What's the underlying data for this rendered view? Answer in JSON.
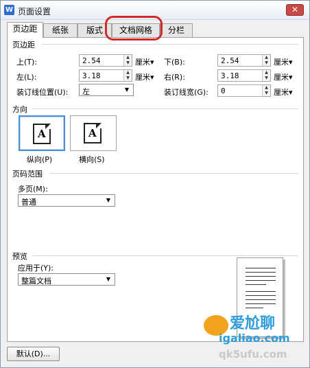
{
  "window": {
    "title": "页面设置",
    "icon": "W",
    "close": "✕"
  },
  "tabs": [
    "页边距",
    "纸张",
    "版式",
    "文档网格",
    "分栏"
  ],
  "margins": {
    "section_title": "页边距",
    "top": {
      "label": "上(T):",
      "value": "2.54",
      "unit": "厘米"
    },
    "bottom": {
      "label": "下(B):",
      "value": "2.54",
      "unit": "厘米"
    },
    "left": {
      "label": "左(L):",
      "value": "3.18",
      "unit": "厘米"
    },
    "right": {
      "label": "右(R):",
      "value": "3.18",
      "unit": "厘米"
    },
    "gutter_pos": {
      "label": "装订线位置(U):",
      "value": "左"
    },
    "gutter_width": {
      "label": "装订线宽(G):",
      "value": "0",
      "unit": "厘米"
    }
  },
  "orientation": {
    "section_title": "方向",
    "portrait": "纵向(P)",
    "landscape": "横向(S)",
    "glyph": "A",
    "selected": "portrait"
  },
  "pages": {
    "section_title": "页码范围",
    "multi_label": "多页(M):",
    "multi_value": "普通"
  },
  "preview": {
    "section_title": "预览",
    "apply_label": "应用于(Y):",
    "apply_value": "整篇文档"
  },
  "buttons": {
    "default": "默认(D)..."
  },
  "watermark": {
    "brand": "爱尬聊",
    "url": "igaliao.com",
    "extra": "qk5ufu.com"
  },
  "colors": {
    "highlight_circle": "#d22a2a",
    "selected_border": "#4a90d9",
    "title_icon": "#2d6cd1"
  }
}
